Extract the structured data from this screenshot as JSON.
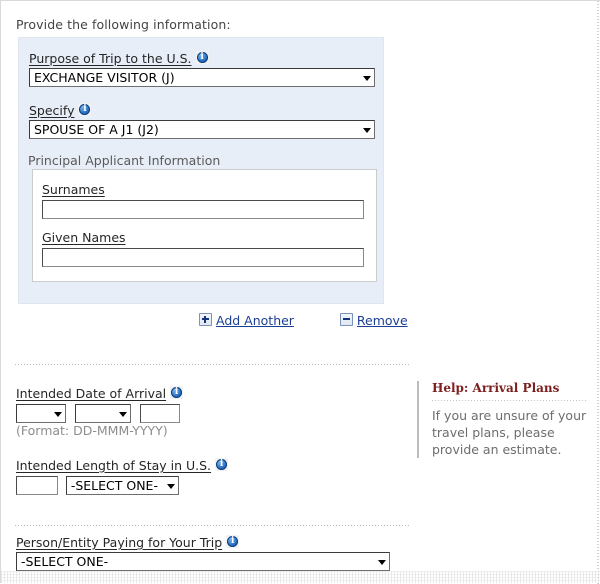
{
  "page": {
    "intro_text": "Provide the following information:"
  },
  "trip_group": {
    "purpose": {
      "label": "Purpose of Trip to the U.S.",
      "info_icon": "info-icon",
      "value": "EXCHANGE VISITOR (J)"
    },
    "specify": {
      "label": "Specify",
      "info_icon": "info-icon",
      "value": "SPOUSE OF A J1 (J2)"
    },
    "principal_applicant": {
      "legend": "Principal Applicant Information",
      "surnames": {
        "label": "Surnames",
        "value": "",
        "placeholder": ""
      },
      "given_names": {
        "label": "Given Names",
        "value": "",
        "placeholder": ""
      }
    },
    "actions": {
      "add_label": "Add Another",
      "add_icon": "plus-icon",
      "remove_label": "Remove",
      "remove_icon": "minus-icon"
    }
  },
  "arrival": {
    "label": "Intended Date of Arrival",
    "info_icon": "info-icon",
    "day_value": "",
    "month_value": "",
    "year_value": "",
    "format_note": "(Format: DD-MMM-YYYY)"
  },
  "length_of_stay": {
    "label": "Intended Length of Stay in U.S.",
    "info_icon": "info-icon",
    "number_value": "",
    "unit_value": "-SELECT ONE-"
  },
  "payer": {
    "label": "Person/Entity Paying for Your Trip",
    "info_icon": "info-icon",
    "value": "-SELECT ONE-"
  },
  "help": {
    "title_prefix": "Help:",
    "title_topic": "Arrival Plans",
    "body": "If you are unsure of your travel plans, please provide an estimate."
  },
  "colors": {
    "panel_bg": "#e8eef7",
    "link": "#1b3f94",
    "help_heading": "#7b1f1f",
    "info_blue": "#2a72c4"
  }
}
